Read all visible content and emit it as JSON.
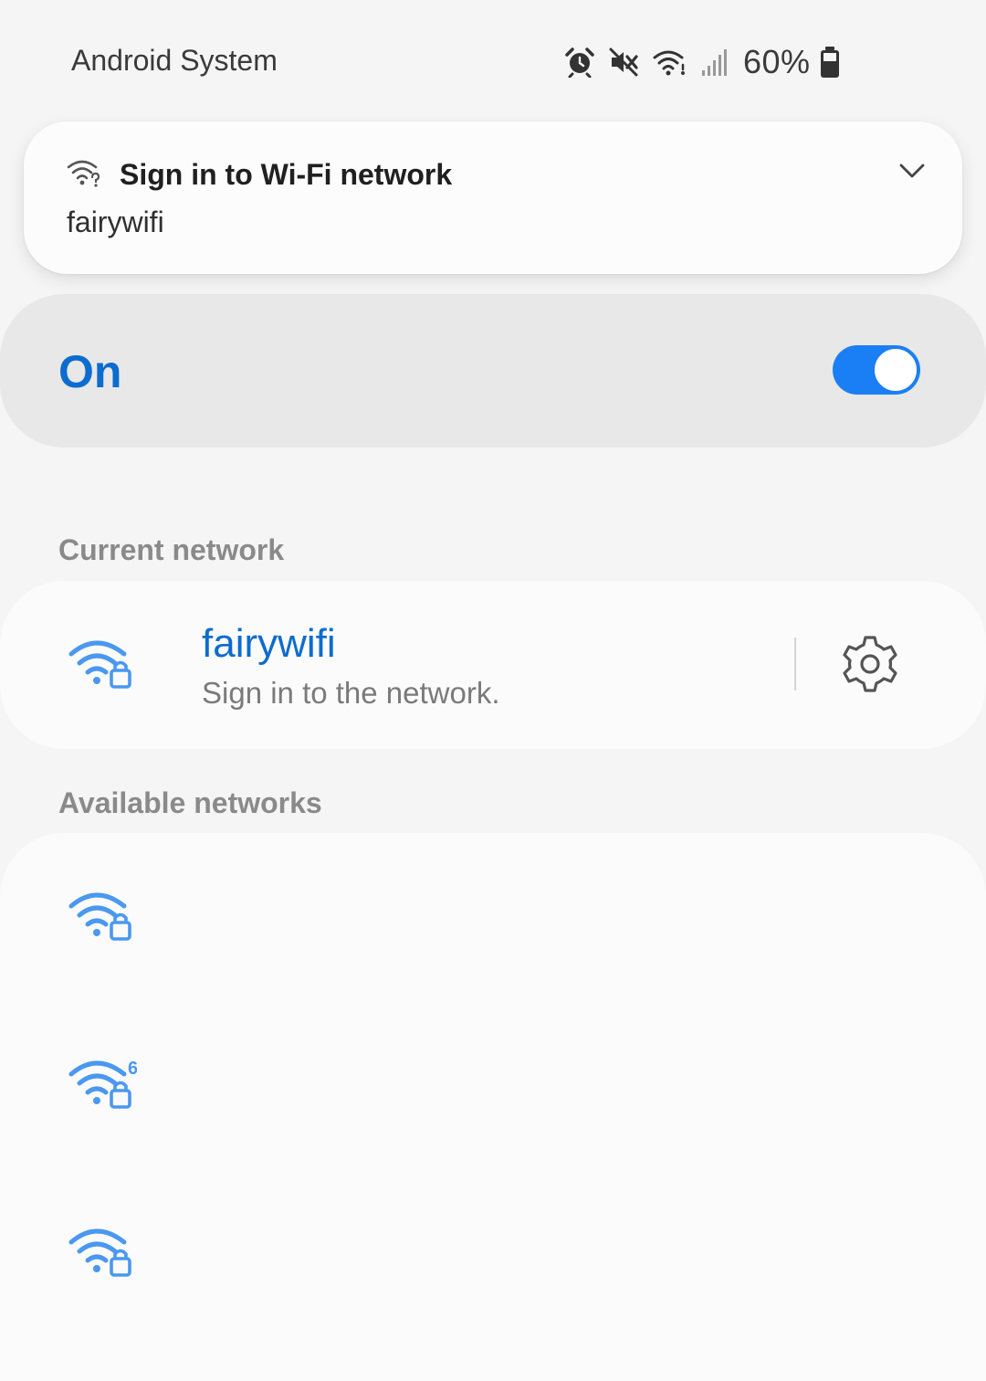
{
  "status_bar": {
    "title": "Android System",
    "icons": [
      "alarm-icon",
      "vibrate-mute-icon",
      "wifi-question-icon",
      "signal-icon",
      "battery-icon"
    ],
    "battery_percent": "60%"
  },
  "notification": {
    "icon": "wifi-question-icon",
    "title": "Sign in to Wi-Fi network",
    "subtitle": "fairywifi",
    "expand_icon": "chevron-down-icon"
  },
  "master_toggle": {
    "label": "On",
    "state": true,
    "accent_color": "#1a7ff5"
  },
  "current_network": {
    "section_label": "Current network",
    "name": "fairywifi",
    "status": "Sign in to the network.",
    "icon": "wifi-lock-icon",
    "settings_icon": "gear-icon"
  },
  "available_networks": {
    "section_label": "Available networks",
    "items": [
      {
        "icon": "wifi-lock-icon",
        "name": ""
      },
      {
        "icon": "wifi6-lock-icon",
        "name": ""
      },
      {
        "icon": "wifi-lock-icon",
        "name": ""
      }
    ]
  },
  "colors": {
    "accent_blue": "#0c6ccf",
    "icon_blue": "#4a98f0",
    "background": "#f5f5f5"
  }
}
